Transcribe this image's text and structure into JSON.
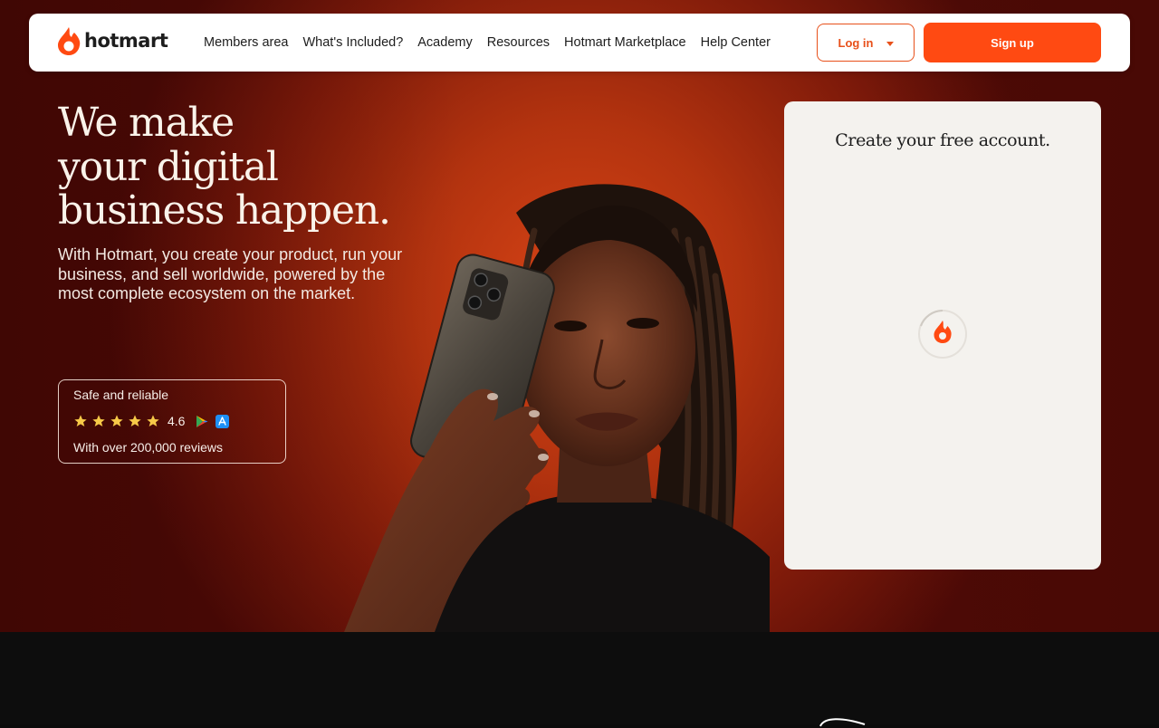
{
  "brand": {
    "name": "hotmart",
    "accent": "#ff4a12"
  },
  "nav": {
    "links": [
      {
        "label": "Members area"
      },
      {
        "label": "What's Included?"
      },
      {
        "label": "Academy"
      },
      {
        "label": "Resources"
      },
      {
        "label": "Hotmart Marketplace"
      },
      {
        "label": "Help Center"
      }
    ],
    "login_label": "Log in",
    "signup_label": "Sign up"
  },
  "hero": {
    "headline_lines": [
      "We make",
      "your digital",
      "business happen."
    ],
    "subheadline": "With Hotmart, you create your product, run your business, and sell worldwide, powered by the most complete ecosystem on the market."
  },
  "rating": {
    "title": "Safe and reliable",
    "stars": 5,
    "score": "4.6",
    "store_icons": [
      "google-play-icon",
      "app-store-icon"
    ],
    "reviews_text": "With over 200,000 reviews"
  },
  "signup_card": {
    "title": "Create your free account.",
    "state": "loading"
  }
}
